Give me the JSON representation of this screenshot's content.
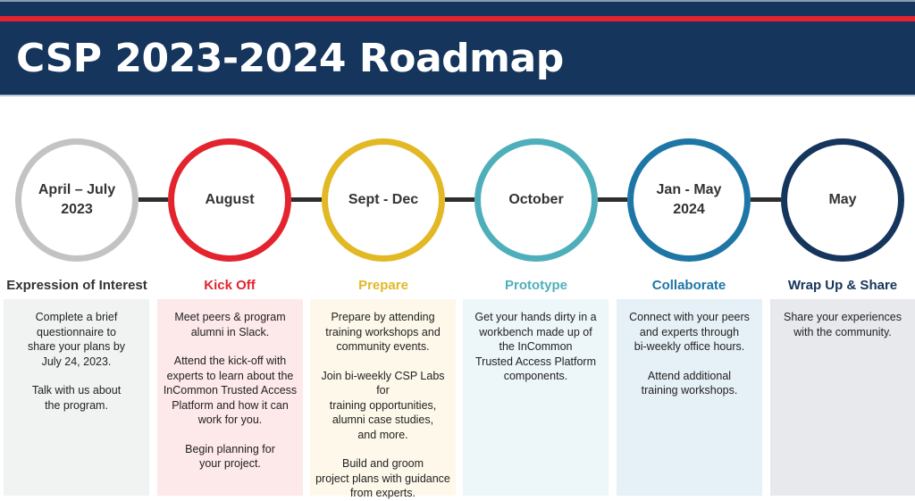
{
  "header": {
    "title": "CSP 2023-2024 Roadmap",
    "colors": {
      "background": "#15355c",
      "accent_line": "#e3232e"
    }
  },
  "stages": [
    {
      "period": "April – July\n2023",
      "title": "Expression of Interest",
      "ring_color": "#c3c3c3",
      "title_color": "#333333",
      "panel_color": "#f1f2f2",
      "paragraphs": [
        "Complete a brief\nquestionnaire to\nshare your plans by\nJuly 24, 2023.",
        "Talk with us about\nthe program."
      ]
    },
    {
      "period": "August",
      "title": "Kick Off",
      "ring_color": "#e3232e",
      "title_color": "#e3232e",
      "panel_color": "#fde8ea",
      "paragraphs": [
        "Meet peers & program\nalumni in Slack.",
        "Attend the kick-off with\nexperts to learn about the\nInCommon Trusted Access\nPlatform and how it can\nwork for you.",
        "Begin planning for\nyour project."
      ]
    },
    {
      "period": "Sept - Dec",
      "title": "Prepare",
      "ring_color": "#e2b824",
      "title_color": "#e2b824",
      "panel_color": "#fdf8ea",
      "paragraphs": [
        "Prepare by attending\ntraining workshops and\ncommunity events.",
        "Join bi-weekly CSP Labs for\ntraining opportunities,\nalumni case studies,\nand more.",
        "Build and groom\nproject plans with guidance\nfrom experts."
      ]
    },
    {
      "period": "October",
      "title": "Prototype",
      "ring_color": "#4eafbb",
      "title_color": "#4eafbb",
      "panel_color": "#edf6f9",
      "paragraphs": [
        "Get your hands dirty in a\nworkbench made up of\nthe InCommon\nTrusted Access Platform\ncomponents."
      ]
    },
    {
      "period": "Jan - May\n2024",
      "title": "Collaborate",
      "ring_color": "#1e76a6",
      "title_color": "#1e76a6",
      "panel_color": "#e6f0f7",
      "paragraphs": [
        "Connect with your peers\nand  experts through\nbi-weekly office hours.",
        "Attend additional\ntraining workshops."
      ]
    },
    {
      "period": "May",
      "title": "Wrap Up & Share",
      "ring_color": "#15355c",
      "title_color": "#15355c",
      "panel_color": "#e8e9ec",
      "paragraphs": [
        "Share your experiences\nwith the community."
      ]
    }
  ]
}
